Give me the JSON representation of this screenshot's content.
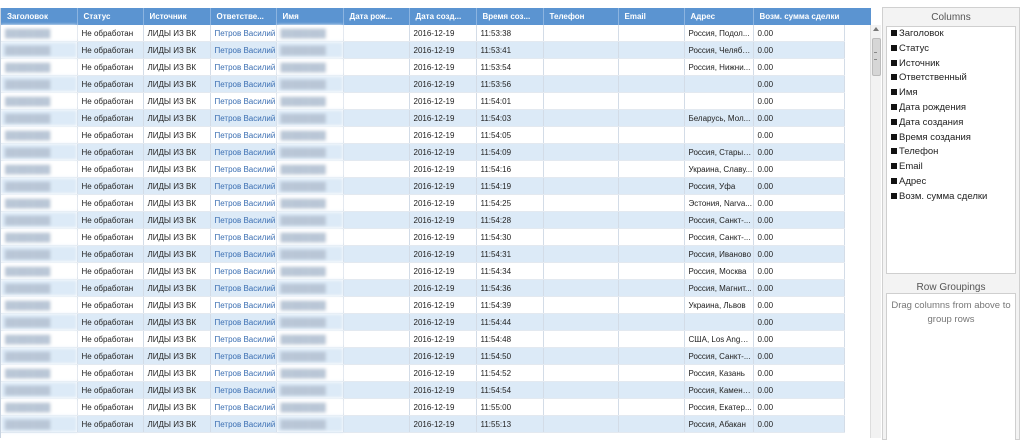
{
  "grid": {
    "columns": [
      "Заголовок",
      "Статус",
      "Источник",
      "Ответстве...",
      "Имя",
      "Дата рож...",
      "Дата созд...",
      "Время соз...",
      "Телефон",
      "Email",
      "Адрес",
      "Возм. сумма сделки"
    ],
    "rows": [
      [
        "Не обработан",
        "ЛИДЫ ИЗ ВК",
        "Петров Василий",
        "2016-12-19",
        "11:53:38",
        "Россия, Подол...",
        "0.00"
      ],
      [
        "Не обработан",
        "ЛИДЫ ИЗ ВК",
        "Петров Василий",
        "2016-12-19",
        "11:53:41",
        "Россия, Челяби...",
        "0.00"
      ],
      [
        "Не обработан",
        "ЛИДЫ ИЗ ВК",
        "Петров Василий",
        "2016-12-19",
        "11:53:54",
        "Россия, Нижни...",
        "0.00"
      ],
      [
        "Не обработан",
        "ЛИДЫ ИЗ ВК",
        "Петров Василий",
        "2016-12-19",
        "11:53:56",
        "",
        "0.00"
      ],
      [
        "Не обработан",
        "ЛИДЫ ИЗ ВК",
        "Петров Василий",
        "2016-12-19",
        "11:54:01",
        "",
        "0.00"
      ],
      [
        "Не обработан",
        "ЛИДЫ ИЗ ВК",
        "Петров Василий",
        "2016-12-19",
        "11:54:03",
        "Беларусь, Мол...",
        "0.00"
      ],
      [
        "Не обработан",
        "ЛИДЫ ИЗ ВК",
        "Петров Василий",
        "2016-12-19",
        "11:54:05",
        "",
        "0.00"
      ],
      [
        "Не обработан",
        "ЛИДЫ ИЗ ВК",
        "Петров Василий",
        "2016-12-19",
        "11:54:09",
        "Россия, Старый...",
        "0.00"
      ],
      [
        "Не обработан",
        "ЛИДЫ ИЗ ВК",
        "Петров Василий",
        "2016-12-19",
        "11:54:16",
        "Украина, Славу...",
        "0.00"
      ],
      [
        "Не обработан",
        "ЛИДЫ ИЗ ВК",
        "Петров Василий",
        "2016-12-19",
        "11:54:19",
        "Россия, Уфа",
        "0.00"
      ],
      [
        "Не обработан",
        "ЛИДЫ ИЗ ВК",
        "Петров Василий",
        "2016-12-19",
        "11:54:25",
        "Эстония, Narva...",
        "0.00"
      ],
      [
        "Не обработан",
        "ЛИДЫ ИЗ ВК",
        "Петров Василий",
        "2016-12-19",
        "11:54:28",
        "Россия, Санкт-...",
        "0.00"
      ],
      [
        "Не обработан",
        "ЛИДЫ ИЗ ВК",
        "Петров Василий",
        "2016-12-19",
        "11:54:30",
        "Россия, Санкт-...",
        "0.00"
      ],
      [
        "Не обработан",
        "ЛИДЫ ИЗ ВК",
        "Петров Василий",
        "2016-12-19",
        "11:54:31",
        "Россия, Иваново",
        "0.00"
      ],
      [
        "Не обработан",
        "ЛИДЫ ИЗ ВК",
        "Петров Василий",
        "2016-12-19",
        "11:54:34",
        "Россия, Москва",
        "0.00"
      ],
      [
        "Не обработан",
        "ЛИДЫ ИЗ ВК",
        "Петров Василий",
        "2016-12-19",
        "11:54:36",
        "Россия, Магнит...",
        "0.00"
      ],
      [
        "Не обработан",
        "ЛИДЫ ИЗ ВК",
        "Петров Василий",
        "2016-12-19",
        "11:54:39",
        "Украина, Львов",
        "0.00"
      ],
      [
        "Не обработан",
        "ЛИДЫ ИЗ ВК",
        "Петров Василий",
        "2016-12-19",
        "11:54:44",
        "",
        "0.00"
      ],
      [
        "Не обработан",
        "ЛИДЫ ИЗ ВК",
        "Петров Василий",
        "2016-12-19",
        "11:54:48",
        "США, Los Angeles",
        "0.00"
      ],
      [
        "Не обработан",
        "ЛИДЫ ИЗ ВК",
        "Петров Василий",
        "2016-12-19",
        "11:54:50",
        "Россия, Санкт-...",
        "0.00"
      ],
      [
        "Не обработан",
        "ЛИДЫ ИЗ ВК",
        "Петров Василий",
        "2016-12-19",
        "11:54:52",
        "Россия, Казань",
        "0.00"
      ],
      [
        "Не обработан",
        "ЛИДЫ ИЗ ВК",
        "Петров Василий",
        "2016-12-19",
        "11:54:54",
        "Россия, Каменс...",
        "0.00"
      ],
      [
        "Не обработан",
        "ЛИДЫ ИЗ ВК",
        "Петров Василий",
        "2016-12-19",
        "11:55:00",
        "Россия, Екатер...",
        "0.00"
      ],
      [
        "Не обработан",
        "ЛИДЫ ИЗ ВК",
        "Петров Василий",
        "2016-12-19",
        "11:55:13",
        "Россия, Абакан",
        "0.00"
      ]
    ]
  },
  "panel": {
    "columns_title": "Columns",
    "column_items": [
      "Заголовок",
      "Статус",
      "Источник",
      "Ответственный",
      "Имя",
      "Дата рождения",
      "Дата создания",
      "Время создания",
      "Телефон",
      "Email",
      "Адрес",
      "Возм. сумма сделки"
    ],
    "groupings_title": "Row Groupings",
    "groupings_hint": "Drag columns from above to group rows"
  },
  "colors": {
    "header_bg": "#5b94d1",
    "row_alt_bg": "#dceaf7",
    "link": "#3a6eb2"
  }
}
